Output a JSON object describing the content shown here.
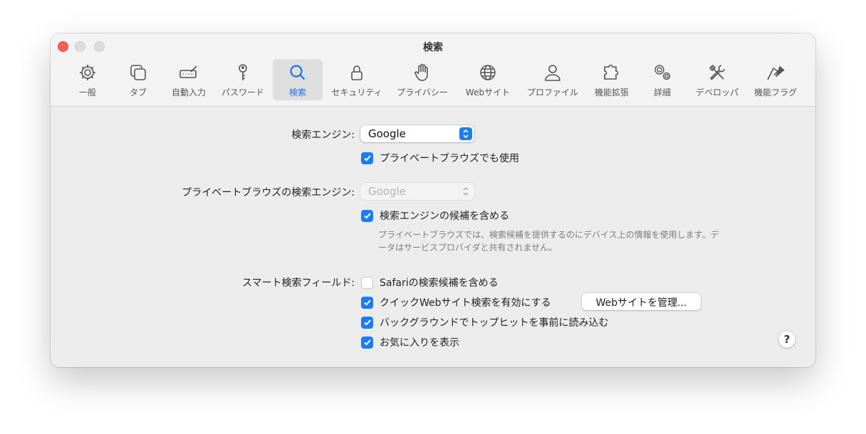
{
  "window": {
    "title": "検索"
  },
  "toolbar": {
    "items": [
      {
        "label": "一般",
        "icon": "gear-icon"
      },
      {
        "label": "タブ",
        "icon": "tabs-icon"
      },
      {
        "label": "自動入力",
        "icon": "autofill-icon"
      },
      {
        "label": "パスワード",
        "icon": "key-icon"
      },
      {
        "label": "検索",
        "icon": "search-icon",
        "selected": true
      },
      {
        "label": "セキュリティ",
        "icon": "lock-icon"
      },
      {
        "label": "プライバシー",
        "icon": "hand-icon"
      },
      {
        "label": "Webサイト",
        "icon": "globe-icon"
      },
      {
        "label": "プロファイル",
        "icon": "person-icon"
      },
      {
        "label": "機能拡張",
        "icon": "puzzle-icon"
      },
      {
        "label": "詳細",
        "icon": "gears-icon"
      },
      {
        "label": "デベロッパ",
        "icon": "tools-icon"
      },
      {
        "label": "機能フラグ",
        "icon": "flags-icon"
      }
    ]
  },
  "search": {
    "engine_label": "検索エンジン:",
    "engine_value": "Google",
    "private_same_label": "プライベートブラウズでも使用",
    "private_same_checked": true,
    "private_engine_label": "プライベートブラウズの検索エンジン:",
    "private_engine_value": "Google",
    "suggestions_label": "検索エンジンの候補を含める",
    "suggestions_checked": true,
    "note": "プライベートブラウズでは、検索候補を提供するのにデバイス上の情報を使用します。データはサービスプロバイダと共有されません。",
    "smart_field_label": "スマート検索フィールド:",
    "safari_suggestions_label": "Safariの検索候補を含める",
    "safari_suggestions_checked": false,
    "quick_search_label": "クイックWebサイト検索を有効にする",
    "quick_search_checked": true,
    "manage_button": "Webサイトを管理...",
    "preload_label": "バックグラウンドでトップヒットを事前に読み込む",
    "preload_checked": true,
    "favorites_label": "お気に入りを表示",
    "favorites_checked": true,
    "help": "?"
  },
  "colors": {
    "accent": "#1e7cf2",
    "close": "#fe5f57"
  }
}
